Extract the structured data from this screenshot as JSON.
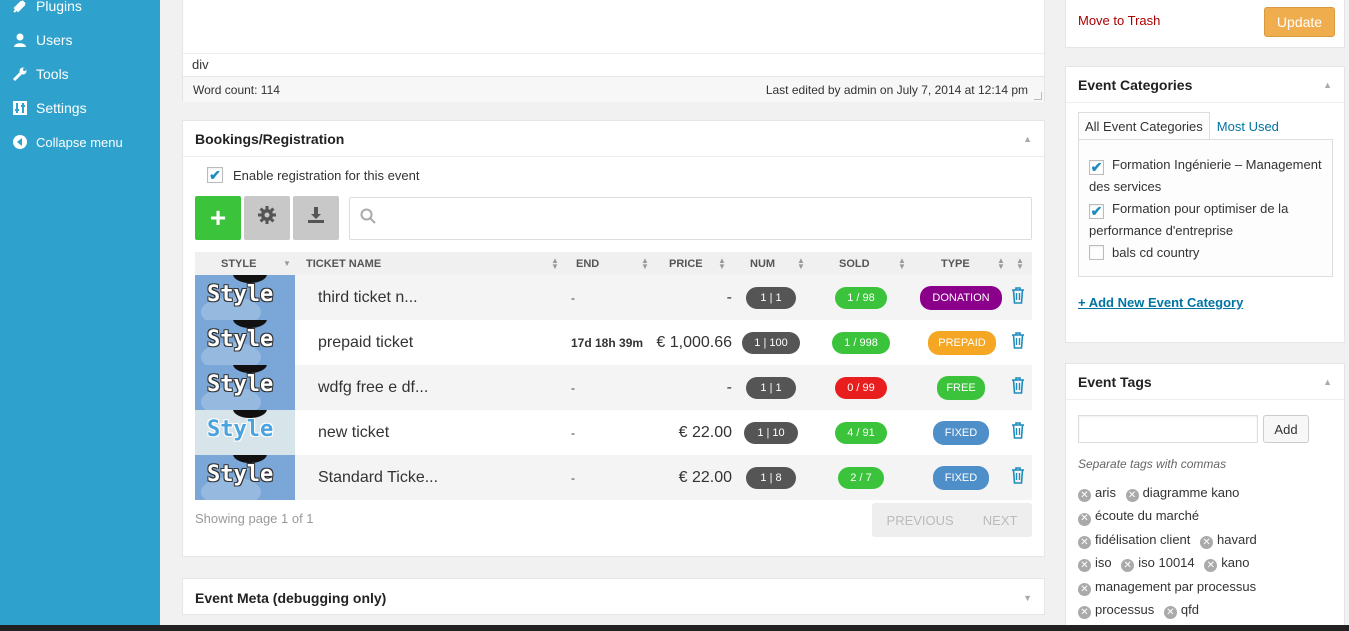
{
  "sidebar": {
    "items": [
      {
        "label": "Plugins",
        "icon": "plugin-icon"
      },
      {
        "label": "Users",
        "icon": "users-icon"
      },
      {
        "label": "Tools",
        "icon": "wrench-icon"
      },
      {
        "label": "Settings",
        "icon": "settings-icon"
      },
      {
        "label": "Collapse menu",
        "icon": "collapse-icon"
      }
    ]
  },
  "editor": {
    "path": "div",
    "word_count": "Word count: 114",
    "last_edited": "Last edited by admin on July 7, 2014 at 12:14 pm"
  },
  "bookings": {
    "title": "Bookings/Registration",
    "enable_label": "Enable registration for this event",
    "enabled": true,
    "columns": {
      "style": "STYLE",
      "ticket_name": "TICKET NAME",
      "end": "END",
      "price": "PRICE",
      "num": "NUM",
      "sold": "SOLD",
      "type": "TYPE"
    },
    "tickets": [
      {
        "style": "Style",
        "name": "third ticket n...",
        "end": "-",
        "price": "-",
        "num": "1 | 1",
        "sold": "1 / 98",
        "type": "DONATION"
      },
      {
        "style": "Style",
        "name": "prepaid ticket",
        "end": "17d 18h 39m",
        "price": "€ 1,000.66",
        "num": "1 | 100",
        "sold": "1 / 998",
        "type": "PREPAID"
      },
      {
        "style": "Style",
        "name": "wdfg free e df...",
        "end": "-",
        "price": "-",
        "num": "1 | 1",
        "sold": "0 / 99",
        "type": "FREE"
      },
      {
        "style": "Style",
        "name": "new ticket",
        "end": "-",
        "price": "€ 22.00",
        "num": "1 | 10",
        "sold": "4 / 91",
        "type": "FIXED"
      },
      {
        "style": "Style",
        "name": "Standard Ticke...",
        "end": "-",
        "price": "€ 22.00",
        "num": "1 | 8",
        "sold": "2 / 7",
        "type": "FIXED"
      }
    ],
    "showing": "Showing page 1 of 1",
    "pager": {
      "previous": "PREVIOUS",
      "next": "NEXT"
    },
    "colors": {
      "add": "#3bc43b",
      "num_pill": "#555555",
      "sold_green": "#3bc43b",
      "sold_red": "#e81e1e",
      "donation": "#8b008b",
      "prepaid": "#f5a623",
      "free": "#3bc43b",
      "fixed": "#4f8fc9"
    }
  },
  "event_meta": {
    "title": "Event Meta (debugging only)"
  },
  "publish": {
    "trash": "Move to Trash",
    "update": "Update"
  },
  "categories": {
    "title": "Event Categories",
    "tab_all": "All Event Categories",
    "tab_used": "Most Used",
    "items": [
      {
        "label": "Formation Ingénierie – Management des services",
        "checked": true
      },
      {
        "label": "Formation pour optimiser de la performance d'entreprise",
        "checked": true
      },
      {
        "label": "bals cd country",
        "checked": false
      }
    ],
    "add_new": "+ Add New Event Category"
  },
  "tags": {
    "title": "Event Tags",
    "add_button": "Add",
    "hint": "Separate tags with commas",
    "items": [
      "aris",
      "diagramme kano",
      "écoute du marché",
      "fidélisation client",
      "havard",
      "iso",
      "iso 10014",
      "kano",
      "management par processus",
      "processus",
      "qfd"
    ]
  }
}
